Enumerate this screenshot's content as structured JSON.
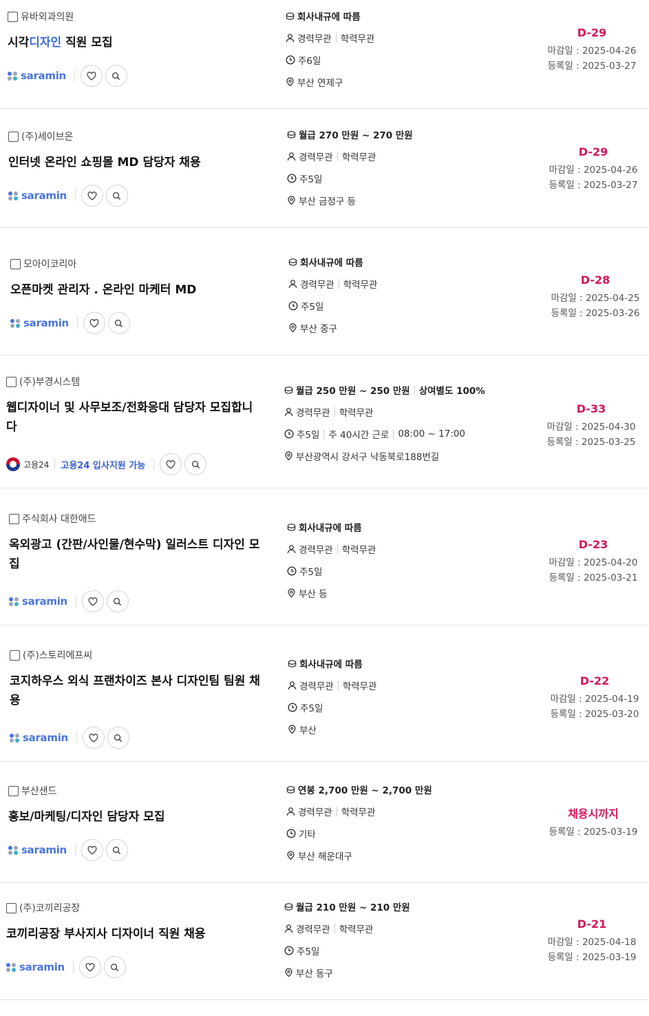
{
  "jobs": [
    {
      "company": "유바외과의원",
      "title_pre": "시각",
      "title_hl": "디자인",
      "title_post": " 직원 모집",
      "salary": "회사내규에 따름",
      "career": "경력무관",
      "edu": "학력무관",
      "work": [
        "주6일"
      ],
      "location": "부산 연제구",
      "dday": "D-29",
      "deadline": "마감일 : 2025-04-26",
      "registered": "등록일 : 2025-03-27",
      "source": "saramin"
    },
    {
      "company": "(주)세이브온",
      "title_pre": "인터넷 온라인 쇼핑몰 MD 담당자 채용",
      "title_hl": "",
      "title_post": "",
      "salary": "월급 270 만원 ~ 270 만원",
      "career": "경력무관",
      "edu": "학력무관",
      "work": [
        "주5일"
      ],
      "location": "부산 금정구 등",
      "dday": "D-29",
      "deadline": "마감일 : 2025-04-26",
      "registered": "등록일 : 2025-03-27",
      "source": "saramin"
    },
    {
      "company": "모아이코리아",
      "title_pre": "오픈마켓 관리자 . 온라인 마케터 MD",
      "title_hl": "",
      "title_post": "",
      "salary": "회사내규에 따름",
      "career": "경력무관",
      "edu": "학력무관",
      "work": [
        "주5일"
      ],
      "location": "부산 중구",
      "dday": "D-28",
      "deadline": "마감일 : 2025-04-25",
      "registered": "등록일 : 2025-03-26",
      "source": "saramin"
    },
    {
      "company": "(주)부경시스템",
      "title_pre": "웹디자이너 및 사무보조/전화응대 담당자 모집합니다",
      "title_hl": "",
      "title_post": "",
      "salary": "월급 250 만원 ~ 250 만원",
      "salary_extra": "상여별도 100%",
      "career": "경력무관",
      "edu": "학력무관",
      "work": [
        "주5일",
        "주 40시간 근로",
        "08:00 ~ 17:00"
      ],
      "location": "부산광역시 강서구 낙동북로188번길",
      "dday": "D-33",
      "deadline": "마감일 : 2025-04-30",
      "registered": "등록일 : 2025-03-25",
      "source": "goyong24",
      "source_name": "고용24",
      "source_tag": "고용24 입사지원 가능"
    },
    {
      "company": "주식회사 대한애드",
      "title_pre": "옥외광고 (간판/사인물/현수막) 일러스트 디자인 모집",
      "title_hl": "",
      "title_post": "",
      "salary": "회사내규에 따름",
      "career": "경력무관",
      "edu": "학력무관",
      "work": [
        "주5일"
      ],
      "location": "부산 등",
      "dday": "D-23",
      "deadline": "마감일 : 2025-04-20",
      "registered": "등록일 : 2025-03-21",
      "source": "saramin"
    },
    {
      "company": "(주)스토리에프씨",
      "title_pre": "코지하우스 외식 프랜차이즈 본사 디자인팀 팀원 채용",
      "title_hl": "",
      "title_post": "",
      "salary": "회사내규에 따름",
      "career": "경력무관",
      "edu": "학력무관",
      "work": [
        "주5일"
      ],
      "location": "부산",
      "dday": "D-22",
      "deadline": "마감일 : 2025-04-19",
      "registered": "등록일 : 2025-03-20",
      "source": "saramin"
    },
    {
      "company": "부산샌드",
      "title_pre": "홍보/마케팅/디자인 담당자 모집",
      "title_hl": "",
      "title_post": "",
      "salary": "연봉 2,700 만원 ~ 2,700 만원",
      "career": "경력무관",
      "edu": "학력무관",
      "work": [
        "기타"
      ],
      "location": "부산 해운대구",
      "dday": "채용시까지",
      "deadline": "",
      "registered": "등록일 : 2025-03-19",
      "source": "saramin"
    },
    {
      "company": "(주)코끼리공장",
      "title_pre": "코끼리공장 부사지사 디자이너 직원 채용",
      "title_hl": "",
      "title_post": "",
      "salary": "월급 210 만원 ~ 210 만원",
      "career": "경력무관",
      "edu": "학력무관",
      "work": [
        "주5일"
      ],
      "location": "부산 동구",
      "dday": "D-21",
      "deadline": "마감일 : 2025-04-18",
      "registered": "등록일 : 2025-03-19",
      "source": "saramin"
    }
  ],
  "colors": {
    "accent_dday": "#d6145b",
    "saramin_blue": "#4a75e0",
    "highlight": "#3a6bd8"
  },
  "icons": {
    "salary": "coin-icon",
    "career": "person-icon",
    "work": "clock-icon",
    "location": "pin-icon",
    "like": "heart-icon",
    "search": "search-icon"
  }
}
